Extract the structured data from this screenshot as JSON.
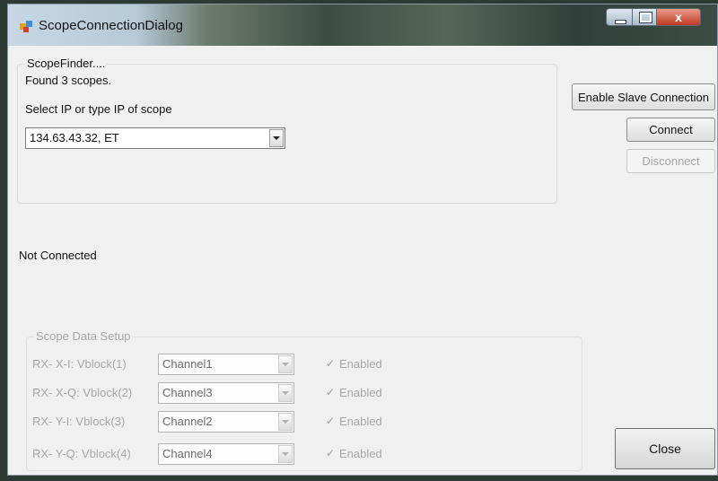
{
  "window": {
    "title": "ScopeConnectionDialog",
    "close_glyph": "x"
  },
  "finder": {
    "legend": "ScopeFinder....",
    "found_text": "Found 3 scopes.",
    "select_label": "Select IP or type IP of scope",
    "selected_ip": "134.63.43.32, ET"
  },
  "buttons": {
    "enable_slave": "Enable Slave Connection",
    "connect": "Connect",
    "disconnect": "Disconnect",
    "close": "Close"
  },
  "status": "Not Connected",
  "scope_setup": {
    "legend": "Scope Data Setup",
    "rows": [
      {
        "label": "RX- X-I:  Vblock(1)",
        "channel": "Channel1",
        "enabled_label": "Enabled",
        "check": "✓"
      },
      {
        "label": "RX- X-Q: Vblock(2)",
        "channel": "Channel3",
        "enabled_label": "Enabled",
        "check": "✓"
      },
      {
        "label": "RX- Y-I:  Vblock(3)",
        "channel": "Channel2",
        "enabled_label": "Enabled",
        "check": "✓"
      },
      {
        "label": "RX- Y-Q: Vblock(4)",
        "channel": "Channel4",
        "enabled_label": "Enabled",
        "check": "✓"
      }
    ]
  }
}
